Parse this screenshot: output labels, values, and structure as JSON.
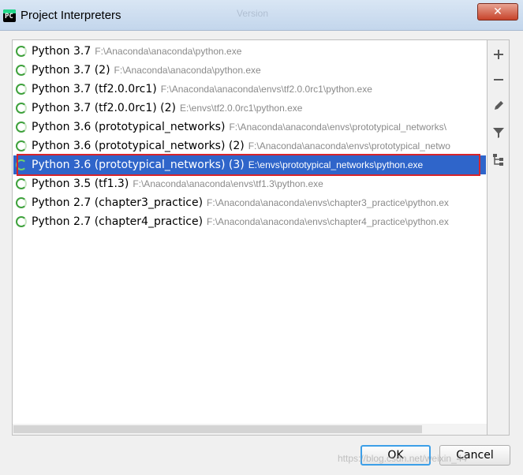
{
  "window": {
    "title": "Project Interpreters",
    "background_title": "Version",
    "close_label": "✕"
  },
  "interpreters": [
    {
      "name": "Python 3.7",
      "path": "F:\\Anaconda\\anaconda\\python.exe",
      "selected": false
    },
    {
      "name": "Python 3.7 (2)",
      "path": "F:\\Anaconda\\anaconda\\python.exe",
      "selected": false
    },
    {
      "name": "Python 3.7 (tf2.0.0rc1)",
      "path": "F:\\Anaconda\\anaconda\\envs\\tf2.0.0rc1\\python.exe",
      "selected": false
    },
    {
      "name": "Python 3.7 (tf2.0.0rc1) (2)",
      "path": "E:\\envs\\tf2.0.0rc1\\python.exe",
      "selected": false
    },
    {
      "name": "Python 3.6 (prototypical_networks)",
      "path": "F:\\Anaconda\\anaconda\\envs\\prototypical_networks\\",
      "selected": false
    },
    {
      "name": "Python 3.6 (prototypical_networks) (2)",
      "path": "F:\\Anaconda\\anaconda\\envs\\prototypical_netwo",
      "selected": false
    },
    {
      "name": "Python 3.6 (prototypical_networks) (3)",
      "path": "E:\\envs\\prototypical_networks\\python.exe",
      "selected": true
    },
    {
      "name": "Python 3.5 (tf1.3)",
      "path": "F:\\Anaconda\\anaconda\\envs\\tf1.3\\python.exe",
      "selected": false
    },
    {
      "name": "Python 2.7 (chapter3_practice)",
      "path": "F:\\Anaconda\\anaconda\\envs\\chapter3_practice\\python.ex",
      "selected": false
    },
    {
      "name": "Python 2.7 (chapter4_practice)",
      "path": "F:\\Anaconda\\anaconda\\envs\\chapter4_practice\\python.ex",
      "selected": false
    }
  ],
  "toolbar": {
    "icons": [
      "add-icon",
      "remove-icon",
      "edit-icon",
      "filter-icon",
      "tree-icon"
    ]
  },
  "buttons": {
    "ok": "OK",
    "cancel": "Cancel"
  },
  "watermark": "https://blog.csdn.net/weixin_44",
  "colors": {
    "selection": "#2f65ca",
    "highlight_border": "#d8242b",
    "ok_focus": "#3c9fe8",
    "status_green": "#3ea13c"
  }
}
